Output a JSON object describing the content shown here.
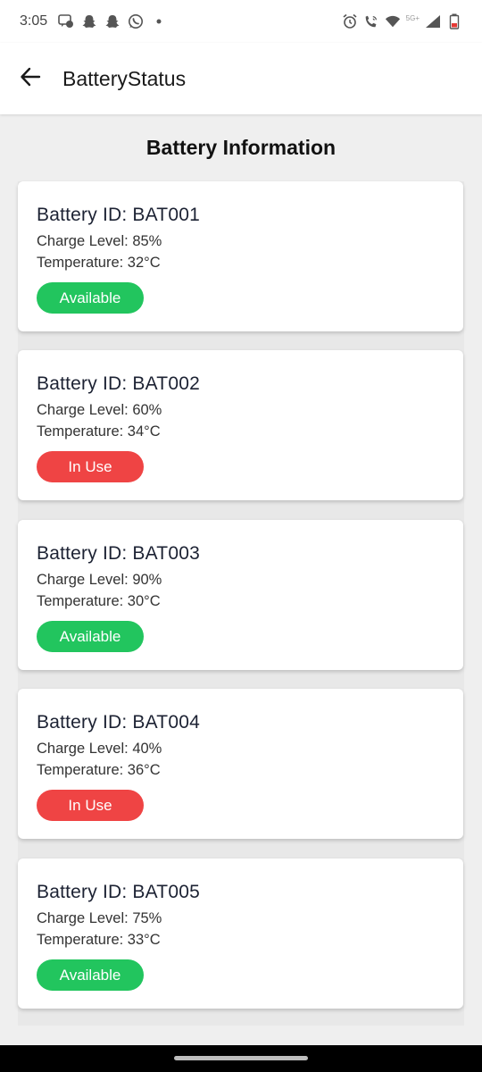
{
  "status_bar": {
    "time": "3:05",
    "left_icons": [
      "messenger-icon",
      "snapchat-icon",
      "snapchat-icon",
      "whatsapp-icon",
      "dot-icon"
    ],
    "right_icons": [
      "alarm-icon",
      "wifi-calling-icon",
      "wifi-icon",
      "cellular-signal-icon",
      "battery-icon"
    ],
    "network_label": "5G+"
  },
  "app_bar": {
    "title": "BatteryStatus",
    "back_icon": "arrow-left-icon"
  },
  "page": {
    "title": "Battery Information"
  },
  "batteries": [
    {
      "id_text": "Battery ID: BAT001",
      "charge_text": "Charge Level: 85%",
      "temp_text": "Temperature: 32°C",
      "status": "Available",
      "status_color": "#22c55e"
    },
    {
      "id_text": "Battery ID: BAT002",
      "charge_text": "Charge Level: 60%",
      "temp_text": "Temperature: 34°C",
      "status": "In Use",
      "status_color": "#ef4444"
    },
    {
      "id_text": "Battery ID: BAT003",
      "charge_text": "Charge Level: 90%",
      "temp_text": "Temperature: 30°C",
      "status": "Available",
      "status_color": "#22c55e"
    },
    {
      "id_text": "Battery ID: BAT004",
      "charge_text": "Charge Level: 40%",
      "temp_text": "Temperature: 36°C",
      "status": "In Use",
      "status_color": "#ef4444"
    },
    {
      "id_text": "Battery ID: BAT005",
      "charge_text": "Charge Level: 75%",
      "temp_text": "Temperature: 33°C",
      "status": "Available",
      "status_color": "#22c55e"
    }
  ],
  "colors": {
    "available": "#22c55e",
    "in_use": "#ef4444",
    "background": "#efefef",
    "card": "#ffffff"
  }
}
